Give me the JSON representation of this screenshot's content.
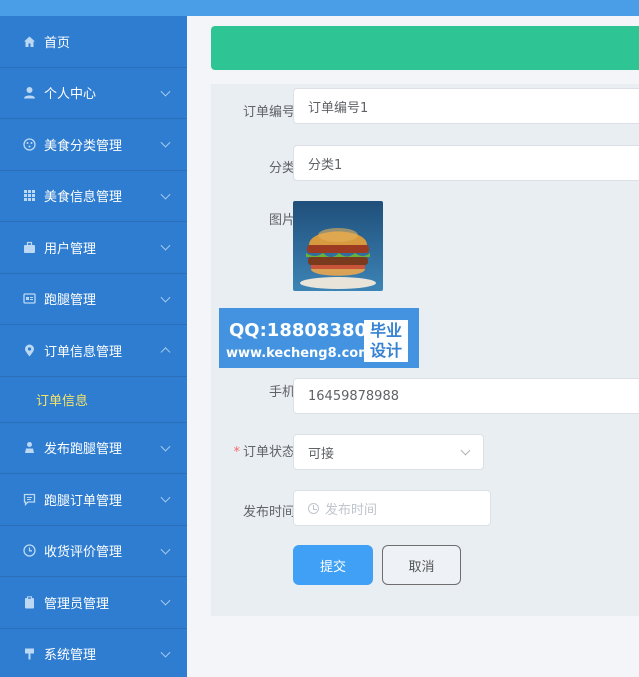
{
  "sidebar": {
    "items": [
      {
        "label": "首页",
        "icon": "home-icon",
        "arrow": false
      },
      {
        "label": "个人中心",
        "icon": "user-icon",
        "arrow": true
      },
      {
        "label": "美食分类管理",
        "icon": "category-icon",
        "arrow": true
      },
      {
        "label": "美食信息管理",
        "icon": "grid-icon",
        "arrow": true
      },
      {
        "label": "用户管理",
        "icon": "briefcase-icon",
        "arrow": true
      },
      {
        "label": "跑腿管理",
        "icon": "card-icon",
        "arrow": true
      },
      {
        "label": "订单信息管理",
        "icon": "location-icon",
        "arrow": true,
        "expanded": true
      },
      {
        "label": "发布跑腿管理",
        "icon": "person-icon",
        "arrow": true
      },
      {
        "label": "跑腿订单管理",
        "icon": "chat-icon",
        "arrow": true
      },
      {
        "label": "收货评价管理",
        "icon": "clock-icon",
        "arrow": true
      },
      {
        "label": "管理员管理",
        "icon": "clipboard-icon",
        "arrow": true
      },
      {
        "label": "系统管理",
        "icon": "pin-icon",
        "arrow": true
      }
    ],
    "sub_item": "订单信息"
  },
  "form": {
    "order_no_label": "订单编号",
    "order_no_value": "订单编号1",
    "category_label": "分类",
    "category_value": "分类1",
    "image_label": "图片",
    "phone_label": "手机",
    "phone_value": "16459878988",
    "status_label": "订单状态",
    "status_required": "*",
    "status_value": "可接",
    "time_label": "发布时间",
    "time_placeholder": "发布时间",
    "submit_label": "提交",
    "cancel_label": "取消"
  },
  "watermark": {
    "qq": "QQ:188083800",
    "url": "www.kecheng8.com",
    "badge_line1": "毕业",
    "badge_line2": "设计"
  },
  "colors": {
    "sidebar": "#2e7dd1",
    "banner": "#2ec494",
    "submit": "#3fa0f5",
    "active_sub": "#f5e46a"
  }
}
